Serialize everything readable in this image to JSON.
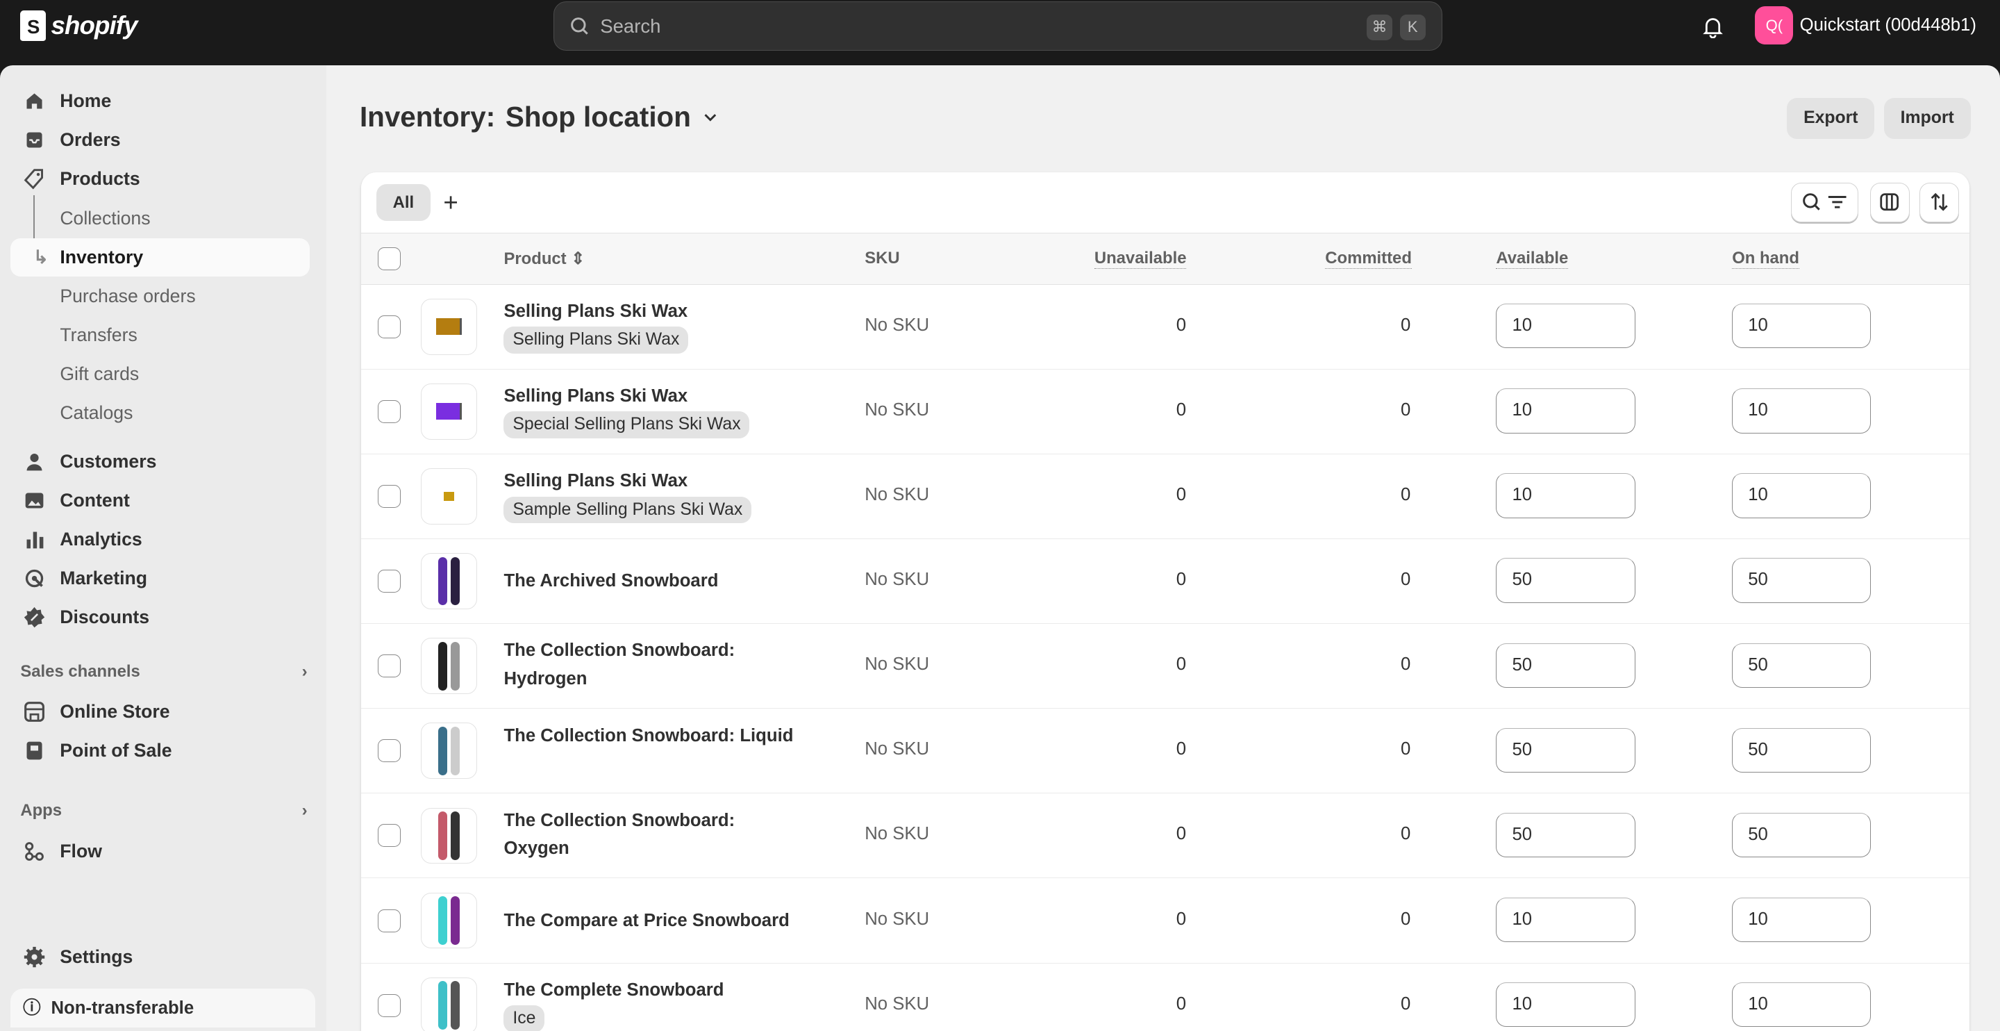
{
  "topbar": {
    "logo": "shopify",
    "search_placeholder": "Search",
    "shortcut": [
      "⌘",
      "K"
    ],
    "avatar_initials": "Q(",
    "store_name": "Quickstart (00d448b1)"
  },
  "sidebar": {
    "items": [
      {
        "label": "Home",
        "icon": "home-icon"
      },
      {
        "label": "Orders",
        "icon": "inbox-icon"
      },
      {
        "label": "Products",
        "icon": "tag-icon"
      }
    ],
    "product_subitems": [
      "Collections",
      "Inventory",
      "Purchase orders",
      "Transfers",
      "Gift cards",
      "Catalogs"
    ],
    "active": "Inventory",
    "items2": [
      {
        "label": "Customers",
        "icon": "person-icon"
      },
      {
        "label": "Content",
        "icon": "image-icon"
      },
      {
        "label": "Analytics",
        "icon": "bar-chart-icon"
      },
      {
        "label": "Marketing",
        "icon": "target-icon"
      },
      {
        "label": "Discounts",
        "icon": "discount-icon"
      }
    ],
    "sales_channels_label": "Sales channels",
    "sales_channels": [
      {
        "label": "Online Store",
        "icon": "store-icon"
      },
      {
        "label": "Point of Sale",
        "icon": "pos-icon"
      }
    ],
    "apps_label": "Apps",
    "apps": [
      {
        "label": "Flow",
        "icon": "flow-icon"
      }
    ],
    "settings": "Settings",
    "notice": "Non-transferable"
  },
  "page": {
    "title_prefix": "Inventory:",
    "location": "Shop location",
    "export": "Export",
    "import": "Import"
  },
  "table": {
    "tab_all": "All",
    "columns": {
      "product": "Product",
      "sku": "SKU",
      "unavailable": "Unavailable",
      "committed": "Committed",
      "available": "Available",
      "on_hand": "On hand"
    },
    "rows": [
      {
        "name": "Selling Plans Ski Wax",
        "variant": "Selling Plans Ski Wax",
        "sku": "No SKU",
        "unavailable": "0",
        "committed": "0",
        "available": "10",
        "on_hand": "10",
        "thumb": "wax-gold"
      },
      {
        "name": "Selling Plans Ski Wax",
        "variant": "Special Selling Plans Ski Wax",
        "sku": "No SKU",
        "unavailable": "0",
        "committed": "0",
        "available": "10",
        "on_hand": "10",
        "thumb": "wax-purple"
      },
      {
        "name": "Selling Plans Ski Wax",
        "variant": "Sample Selling Plans Ski Wax",
        "sku": "No SKU",
        "unavailable": "0",
        "committed": "0",
        "available": "10",
        "on_hand": "10",
        "thumb": "wax-small"
      },
      {
        "name": "The Archived Snowboard",
        "variant": "",
        "sku": "No SKU",
        "unavailable": "0",
        "committed": "0",
        "available": "50",
        "on_hand": "50",
        "thumb": "board"
      },
      {
        "name": "The Collection Snowboard: Hydrogen",
        "variant": "",
        "sku": "No SKU",
        "unavailable": "0",
        "committed": "0",
        "available": "50",
        "on_hand": "50",
        "thumb": "board"
      },
      {
        "name": "The Collection Snowboard: Liquid",
        "variant": "",
        "sku": "No SKU",
        "unavailable": "0",
        "committed": "0",
        "available": "50",
        "on_hand": "50",
        "thumb": "board"
      },
      {
        "name": "The Collection Snowboard: Oxygen",
        "variant": "",
        "sku": "No SKU",
        "unavailable": "0",
        "committed": "0",
        "available": "50",
        "on_hand": "50",
        "thumb": "board"
      },
      {
        "name": "The Compare at Price Snowboard",
        "variant": "",
        "sku": "No SKU",
        "unavailable": "0",
        "committed": "0",
        "available": "10",
        "on_hand": "10",
        "thumb": "board"
      },
      {
        "name": "The Complete Snowboard",
        "variant": "Ice",
        "sku": "No SKU",
        "unavailable": "0",
        "committed": "0",
        "available": "10",
        "on_hand": "10",
        "thumb": "board"
      }
    ]
  },
  "colors": {
    "topbar": "#1a1a1a",
    "avatar": "#ff4f9a",
    "sidebar": "#ebebeb",
    "main": "#f1f1f1"
  }
}
